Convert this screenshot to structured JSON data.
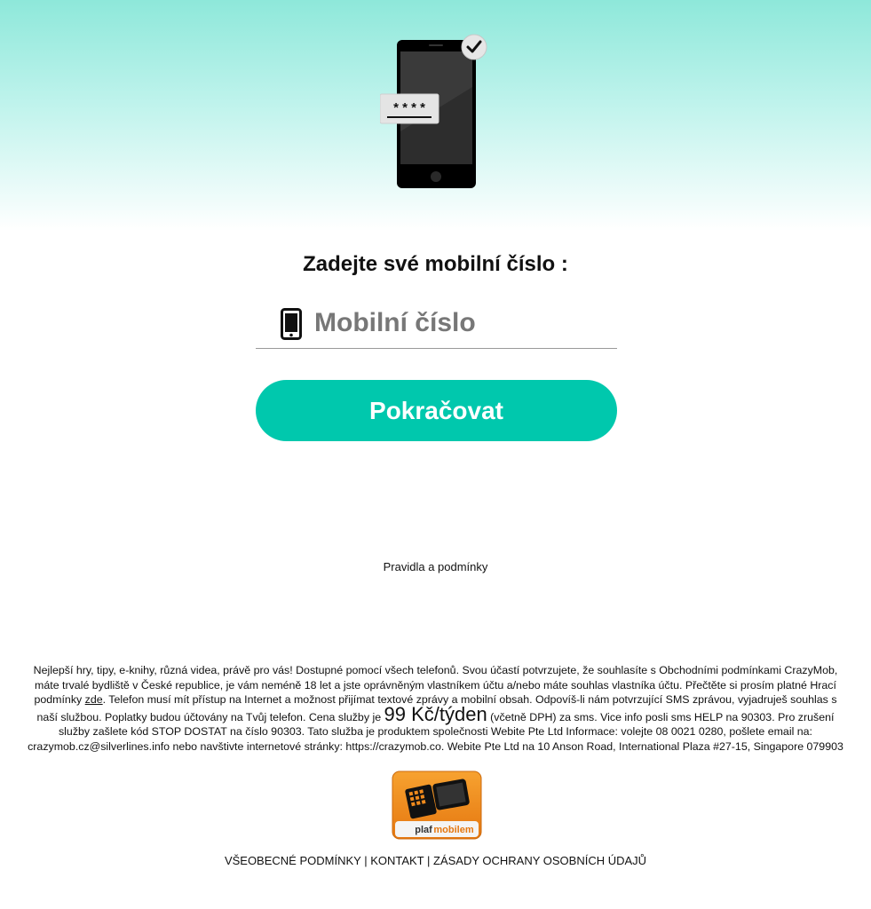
{
  "colors": {
    "accent": "#00c8ad",
    "hero_top": "#8ee8da",
    "badge_orange": "#f08a1c"
  },
  "illustration": {
    "pin_mask": "* * * *",
    "icons": [
      "phone-illustration",
      "check-icon"
    ]
  },
  "form": {
    "heading": "Zadejte své mobilní číslo :",
    "phone_placeholder": "Mobilní číslo",
    "phone_value": "",
    "input_icon": "mobile-phone-icon",
    "continue_label": "Pokračovat"
  },
  "links": {
    "terms": "Pravidla a podmínky"
  },
  "disclaimer": {
    "part1": "Nejlepší hry, tipy, e-knihy, různá videa, právě pro vás! Dostupné pomocí všech telefonů. Svou účastí potvrzujete, že souhlasíte s Obchodními podmínkami CrazyMob, máte trvalé bydliště v České republice, je vám neméně 18 let a jste oprávněným vlastníkem účtu a/nebo máte souhlas vlastníka účtu. Přečtěte si prosím platné Hrací podmínky ",
    "link_here": "zde",
    "part2": ". Telefon musí mít přístup na Internet a možnost přijímat textové zprávy a mobilní obsah. Odpovíš-li nám potvrzující SMS zprávou, vyjadruješ souhlas s naší službou. Poplatky budou účtovány na Tvůj telefon. Cena služby je ",
    "price": "99 Kč/týden",
    "part3": " (včetně DPH) za sms. Vice info posli sms HELP na 90303. Pro zrušení služby zašlete kód STOP DOSTAT na číslo 90303. Tato služba je produktem společnosti Webite Pte Ltd Informace: volejte 08 0021 0280, pošlete email na: crazymob.cz@silverlines.info nebo navštivte internetové stránky: https://crazymob.co. Webite Pte Ltd na 10 Anson Road, International Plaza #27-15, Singapore 079903"
  },
  "badge": {
    "text_plaf": "plaf",
    "text_mobilem": "mobilem"
  },
  "footer": {
    "link1": "VŠEOBECNÉ PODMÍNKY",
    "sep1": " | ",
    "link2": "KONTAKT",
    "sep2": " | ",
    "link3": "ZÁSADY OCHRANY OSOBNÍCH ÚDAJŮ"
  }
}
